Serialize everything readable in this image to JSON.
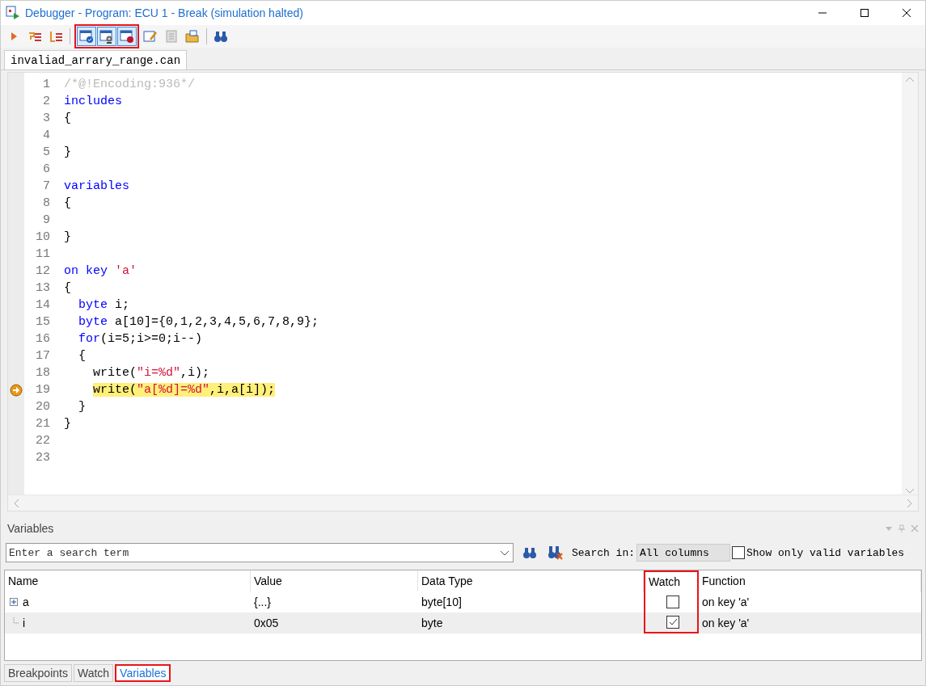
{
  "window": {
    "title": "Debugger - Program: ECU 1 - Break (simulation halted)"
  },
  "editor": {
    "tab": {
      "label": "invaliad_arrary_range.can",
      "selected": true
    },
    "lines": [
      {
        "number": "1",
        "tokens": [
          {
            "text": "/*@!Encoding:936*/",
            "kind": "comment"
          }
        ]
      },
      {
        "number": "2",
        "tokens": [
          {
            "text": "includes",
            "kind": "keyword"
          }
        ]
      },
      {
        "number": "3",
        "tokens": [
          {
            "text": "{",
            "kind": "plain"
          }
        ]
      },
      {
        "number": "4"
      },
      {
        "number": "5",
        "tokens": [
          {
            "text": "}",
            "kind": "plain"
          }
        ]
      },
      {
        "number": "6"
      },
      {
        "number": "7",
        "tokens": [
          {
            "text": "variables",
            "kind": "keyword"
          }
        ]
      },
      {
        "number": "8",
        "tokens": [
          {
            "text": "{",
            "kind": "plain"
          }
        ]
      },
      {
        "number": "9"
      },
      {
        "number": "10",
        "tokens": [
          {
            "text": "}",
            "kind": "plain"
          }
        ]
      },
      {
        "number": "11"
      },
      {
        "number": "12",
        "tokens": [
          {
            "text": "on key",
            "kind": "keyword"
          },
          {
            "text": " 'a'",
            "kind": "string"
          }
        ]
      },
      {
        "number": "13",
        "tokens": [
          {
            "text": "{",
            "kind": "plain"
          }
        ]
      },
      {
        "number": "14",
        "tokens": [
          {
            "text": "  byte",
            "kind": "keyword"
          },
          {
            "text": " i;",
            "kind": "plain"
          }
        ]
      },
      {
        "number": "15",
        "tokens": [
          {
            "text": "  byte",
            "kind": "keyword"
          },
          {
            "text": " a[10]={0,1,2,3,4,5,6,7,8,9};",
            "kind": "plain"
          }
        ]
      },
      {
        "number": "16",
        "tokens": [
          {
            "text": "  for",
            "kind": "keyword"
          },
          {
            "text": "(i=5;i>=0;i--)",
            "kind": "plain"
          }
        ]
      },
      {
        "number": "17",
        "tokens": [
          {
            "text": "  {",
            "kind": "plain"
          }
        ]
      },
      {
        "number": "18",
        "tokens": [
          {
            "text": "    write(",
            "kind": "plain"
          },
          {
            "text": "\"i=%d\"",
            "kind": "string"
          },
          {
            "text": ",i);",
            "kind": "plain"
          }
        ]
      },
      {
        "number": "19",
        "current": true,
        "tokens": [
          {
            "text": "    write(",
            "kind": "plain"
          },
          {
            "text": "\"a[%d]=%d\"",
            "kind": "string"
          },
          {
            "text": ",i,a[i]);",
            "kind": "plain"
          }
        ]
      },
      {
        "number": "20",
        "tokens": [
          {
            "text": "  }",
            "kind": "plain"
          }
        ]
      },
      {
        "number": "21",
        "tokens": [
          {
            "text": "}",
            "kind": "plain"
          }
        ]
      },
      {
        "number": "22"
      },
      {
        "number": "23"
      }
    ]
  },
  "variables_panel": {
    "title": "Variables",
    "search": {
      "placeholder": "Enter a search term"
    },
    "search_in_label": "Search in:",
    "search_in_value": "All columns",
    "valid_only": {
      "label": "Show only valid variables",
      "checked": false
    },
    "columns": [
      {
        "label": "Name",
        "annotated": false
      },
      {
        "label": "Value",
        "annotated": false
      },
      {
        "label": "Data Type",
        "annotated": false
      },
      {
        "label": "Watch",
        "annotated": true
      },
      {
        "label": "Function",
        "annotated": false
      }
    ],
    "rows": [
      {
        "name": "a",
        "expandable": true,
        "selected": false,
        "value": "{...}",
        "type": "byte[10]",
        "watch": false,
        "function": "on key 'a'"
      },
      {
        "name": "i",
        "expandable": false,
        "selected": true,
        "value": "0x05",
        "type": "byte",
        "watch": true,
        "function": "on key 'a'"
      }
    ]
  },
  "bottom_tabs": [
    {
      "label": "Breakpoints",
      "selected": false,
      "annotated": false
    },
    {
      "label": "Watch",
      "selected": false,
      "annotated": false
    },
    {
      "label": "Variables",
      "selected": true,
      "annotated": true
    }
  ]
}
